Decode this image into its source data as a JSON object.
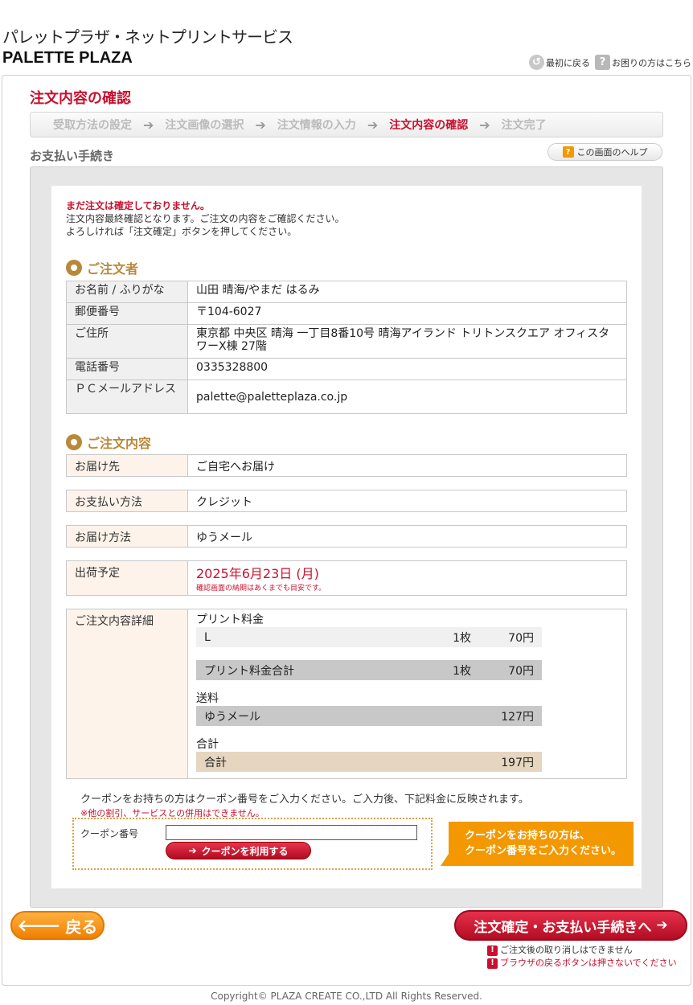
{
  "header": {
    "brand_ja": "パレットプラザ・ネットプリントサービス",
    "brand_en": "PALETTE PLAZA",
    "link_top": "最初に戻る",
    "link_help": "お困りの方はこちら"
  },
  "page_title": "注文内容の確認",
  "steps": [
    {
      "label": "受取方法の設定",
      "active": false
    },
    {
      "label": "注文画像の選択",
      "active": false
    },
    {
      "label": "注文情報の入力",
      "active": false
    },
    {
      "label": "注文内容の確認",
      "active": true
    },
    {
      "label": "注文完了",
      "active": false
    }
  ],
  "section_title": "お支払い手続き",
  "help_button": "この画面のヘルプ",
  "notice": {
    "line1": "まだ注文は確定しておりません。",
    "line2": "注文内容最終確認となります。ご注文の内容をご確認ください。",
    "line3": "よろしければ「注文確定」ボタンを押してください。"
  },
  "orderer": {
    "title": "ご注文者",
    "name_label": "お名前 / ふりがな",
    "name_value": "山田 晴海/やまだ はるみ",
    "zip_label": "郵便番号",
    "zip_value": "〒104-6027",
    "address_label": "ご住所",
    "address_value": "東京都 中央区 晴海 一丁目8番10号 晴海アイランド トリトンスクエア オフィスタワーX棟 27階",
    "phone_label": "電話番号",
    "phone_value": "0335328800",
    "email_label": "ＰＣメールアドレス",
    "email_value": "palette@paletteplaza.co.jp"
  },
  "order": {
    "title": "ご注文内容",
    "dest_label": "お届け先",
    "dest_value": "ご自宅へお届け",
    "pay_label": "お支払い方法",
    "pay_value": "クレジット",
    "delivery_label": "お届け方法",
    "delivery_value": "ゆうメール",
    "ship_label": "出荷予定",
    "ship_value": "2025年6月23日 (月)",
    "ship_note": "確認画面の納期はあくまでも目安です。",
    "detail_label": "ご注文内容詳細",
    "print_title": "プリント料金",
    "print_size": "L",
    "print_count": "1枚",
    "print_price": "70円",
    "print_total_label": "プリント料金合計",
    "print_total_count": "1枚",
    "print_total_price": "70円",
    "shipping_title": "送料",
    "shipping_method": "ゆうメール",
    "shipping_price": "127円",
    "total_title": "合計",
    "total_label": "合計",
    "total_price": "197円"
  },
  "coupon": {
    "text": "クーポンをお持ちの方はクーポン番号をご入力ください。ご入力後、下記料金に反映されます。",
    "warn": "※他の割引、サービスとの併用はできません。",
    "label": "クーポン番号",
    "input_value": "",
    "button": "クーポンを利用する",
    "tip_line1": "クーポンをお持ちの方は、",
    "tip_line2": "クーポン番号をご入力ください。"
  },
  "footer": {
    "back_button": "戻る",
    "confirm_button": "注文確定・お支払い手続きへ",
    "warn1": "ご注文後の取り消しはできません",
    "warn2": "ブラウザの戻るボタンは押さないでください",
    "copyright": "Copyright© PLAZA CREATE CO.,LTD All Rights Reserved."
  },
  "colors": {
    "accent_red": "#c8102e",
    "gold": "#b8893a",
    "orange": "#f39800"
  }
}
